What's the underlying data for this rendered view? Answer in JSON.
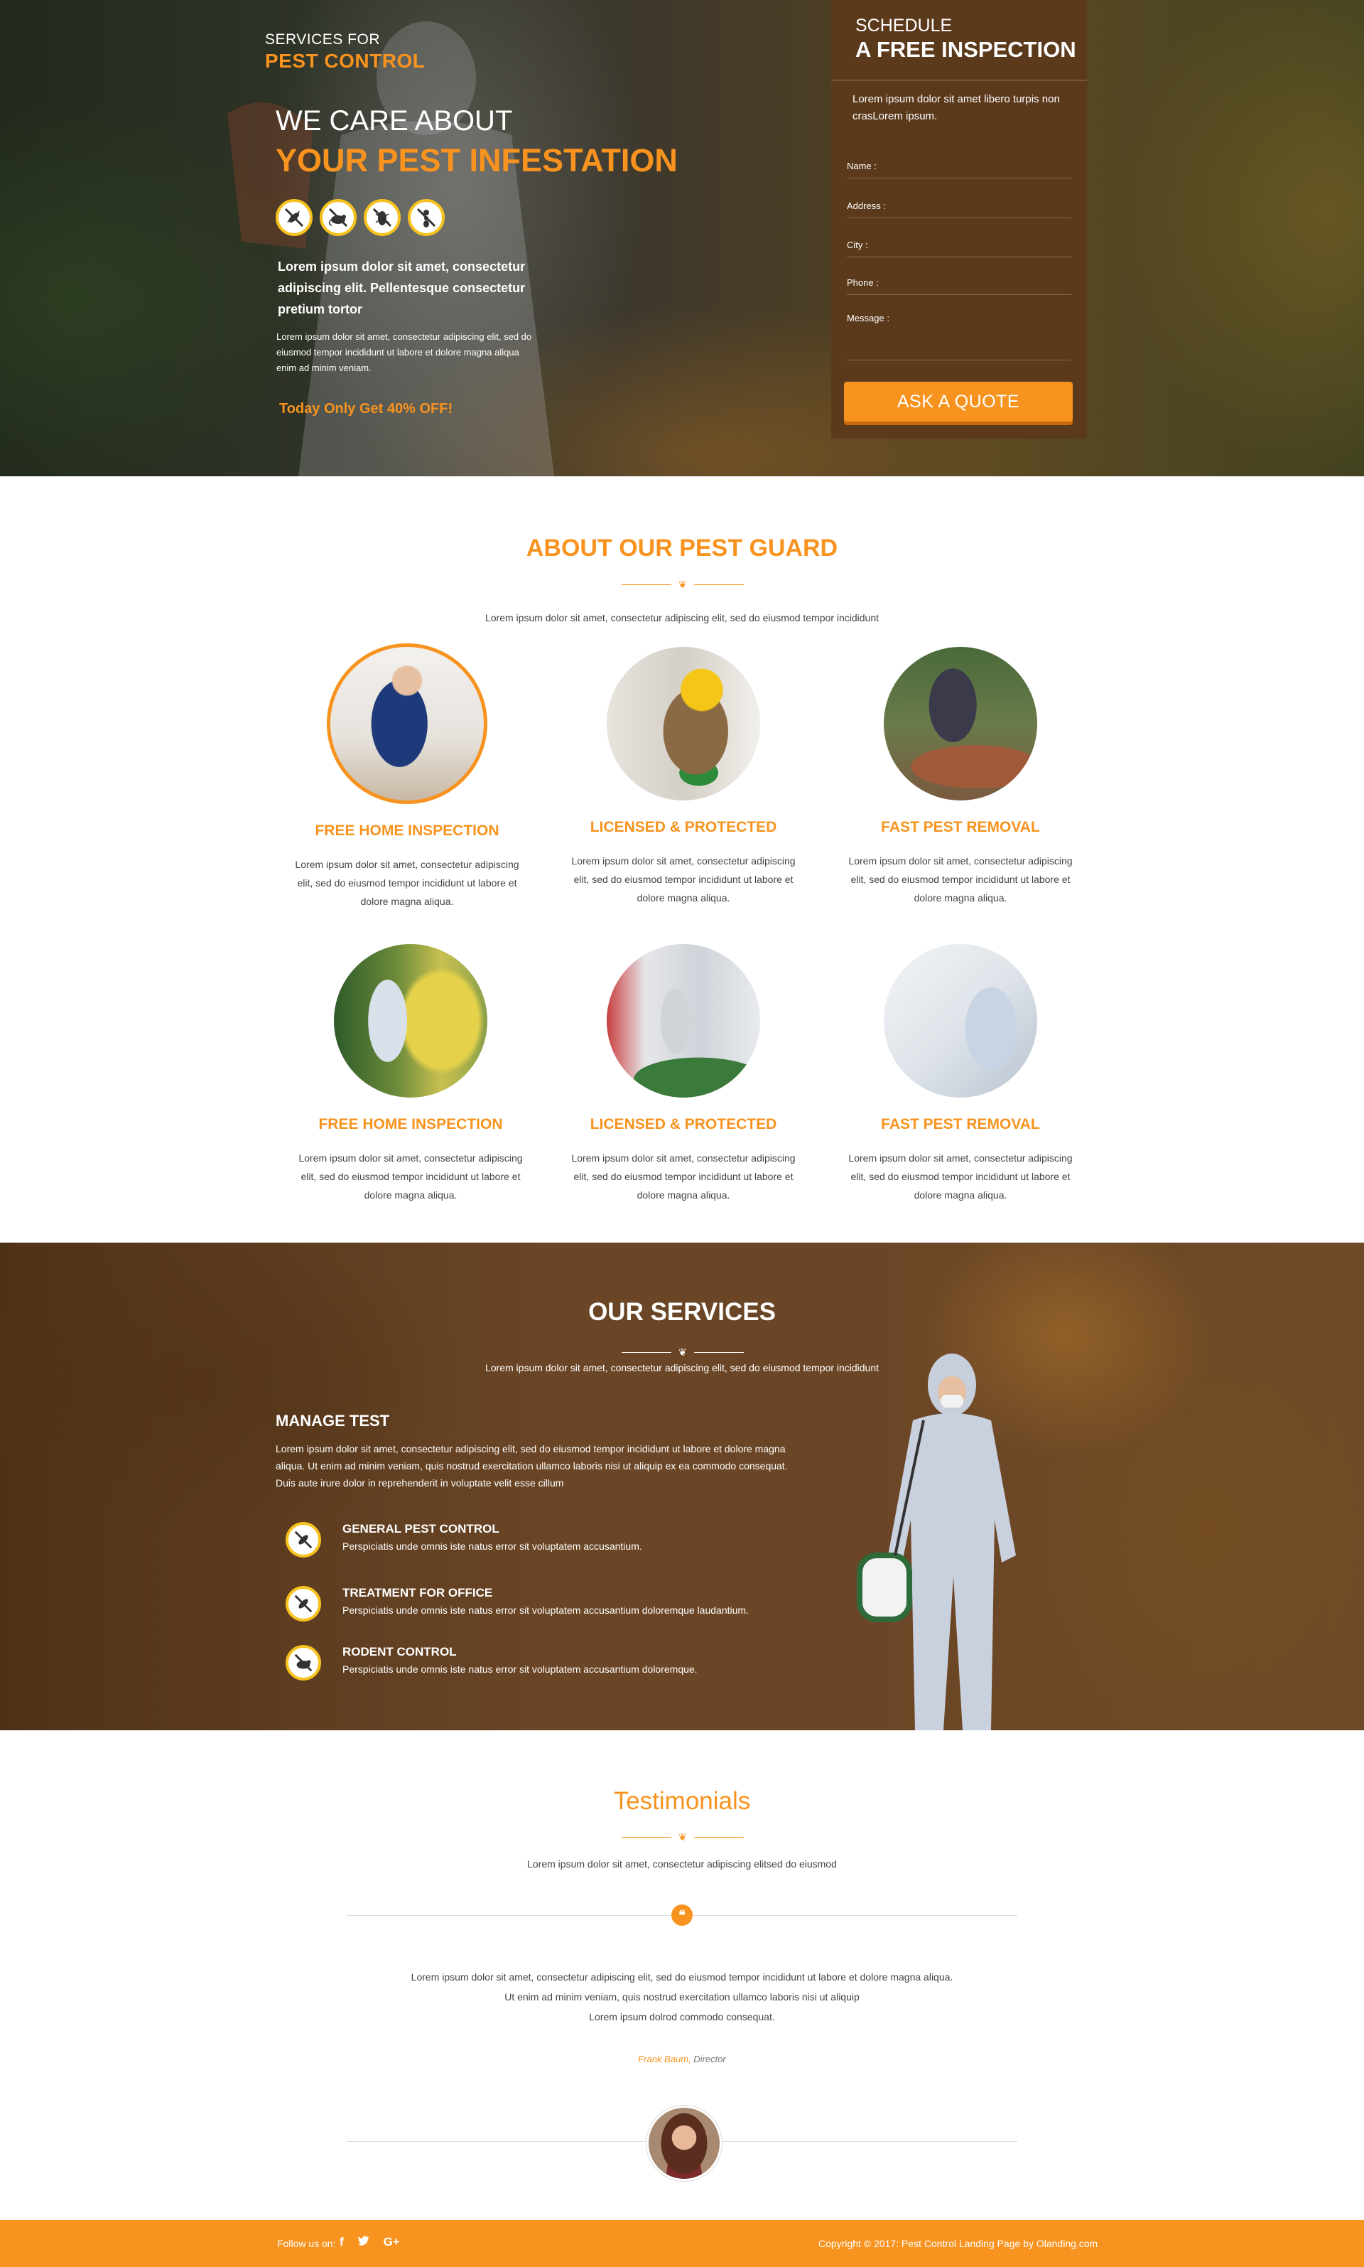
{
  "hero": {
    "eyebrow": "SERVICES FOR",
    "brand": "PEST CONTROL",
    "headline_1": "WE CARE ABOUT",
    "headline_2": "YOUR PEST INFESTATION",
    "pest_icons": [
      "mosquito-icon",
      "rat-icon",
      "cockroach-icon",
      "ant-icon"
    ],
    "bold_text": "Lorem ipsum dolor sit amet, consectetur adipiscing elit. Pellentesque consectetur pretium tortor",
    "small_text": "Lorem ipsum dolor sit amet, consectetur adipiscing elit, sed do eiusmod tempor incididunt ut labore et dolore magna aliqua enim ad minim veniam.",
    "offer": "Today Only Get 40% OFF!"
  },
  "form": {
    "title_1": "SCHEDULE",
    "title_2": "A FREE INSPECTION",
    "intro": "Lorem ipsum dolor sit amet libero turpis non crasLorem ipsum.",
    "fields": [
      "Name :",
      "Address :",
      "City :",
      "Phone :",
      "Message :"
    ],
    "button": "ASK A QUOTE"
  },
  "about": {
    "title": "ABOUT OUR PEST GUARD",
    "subtitle": "Lorem ipsum dolor sit amet, consectetur adipiscing elit, sed do eiusmod tempor incididunt",
    "features": [
      {
        "title": "FREE HOME INSPECTION",
        "desc": "Lorem ipsum dolor sit amet, consectetur adipiscing elit, sed do eiusmod tempor incididunt ut labore et dolore magna aliqua."
      },
      {
        "title": "LICENSED & PROTECTED",
        "desc": "Lorem ipsum dolor sit amet, consectetur adipiscing elit, sed do eiusmod tempor incididunt ut labore et dolore magna aliqua."
      },
      {
        "title": "FAST PEST REMOVAL",
        "desc": "Lorem ipsum dolor sit amet, consectetur adipiscing elit, sed do eiusmod tempor incididunt ut labore et dolore magna aliqua."
      },
      {
        "title": "FREE HOME INSPECTION",
        "desc": "Lorem ipsum dolor sit amet, consectetur adipiscing elit, sed do eiusmod tempor incididunt ut labore et dolore magna aliqua."
      },
      {
        "title": "LICENSED & PROTECTED",
        "desc": "Lorem ipsum dolor sit amet, consectetur adipiscing elit, sed do eiusmod tempor incididunt ut labore et dolore magna aliqua."
      },
      {
        "title": "FAST PEST REMOVAL",
        "desc": "Lorem ipsum dolor sit amet, consectetur adipiscing elit, sed do eiusmod tempor incididunt ut labore et dolore magna aliqua."
      }
    ]
  },
  "services": {
    "title": "OUR SERVICES",
    "subtitle": "Lorem ipsum dolor sit amet, consectetur adipiscing elit, sed do eiusmod tempor incididunt",
    "manage_title": "MANAGE TEST",
    "manage_text": "Lorem ipsum dolor sit amet, consectetur adipiscing elit, sed do eiusmod tempor incididunt ut labore et dolore magna aliqua. Ut enim ad minim veniam, quis nostrud exercitation ullamco laboris nisi ut aliquip ex ea commodo consequat. Duis aute irure dolor in reprehenderit in voluptate velit esse cillum",
    "items": [
      {
        "icon": "mosquito-icon",
        "title": "GENERAL PEST CONTROL",
        "desc": "Perspiciatis unde omnis iste natus error sit voluptatem accusantium."
      },
      {
        "icon": "mosquito-icon",
        "title": "TREATMENT FOR OFFICE",
        "desc": "Perspiciatis unde omnis iste natus error sit voluptatem accusantium doloremque laudantium."
      },
      {
        "icon": "rat-icon",
        "title": "RODENT CONTROL",
        "desc": "Perspiciatis unde omnis iste natus error sit voluptatem accusantium doloremque."
      }
    ]
  },
  "testimonials": {
    "title": "Testimonials",
    "subtitle": "Lorem ipsum dolor sit amet, consectetur adipiscing elitsed do eiusmod",
    "quote_mark": "❝",
    "quote_lines": [
      "Lorem ipsum dolor sit amet, consectetur adipiscing elit, sed do eiusmod tempor incididunt ut labore et dolore magna aliqua.",
      "Ut enim ad minim veniam, quis nostrud exercitation ullamco laboris nisi ut aliquip",
      "Lorem ipsum dolrod commodo consequat."
    ],
    "author_name": "Frank Baum,",
    "author_role": " Director"
  },
  "footer": {
    "follow": "Follow us on:",
    "social": [
      "f",
      "t",
      "G+"
    ],
    "copyright": "Copyright © 2017: Pest Control Landing Page by ",
    "copyright_link": "Olanding.com"
  },
  "colors": {
    "accent": "#f7931e",
    "form_bg": "#5b3a1c",
    "services_bg": "#6a4526"
  }
}
